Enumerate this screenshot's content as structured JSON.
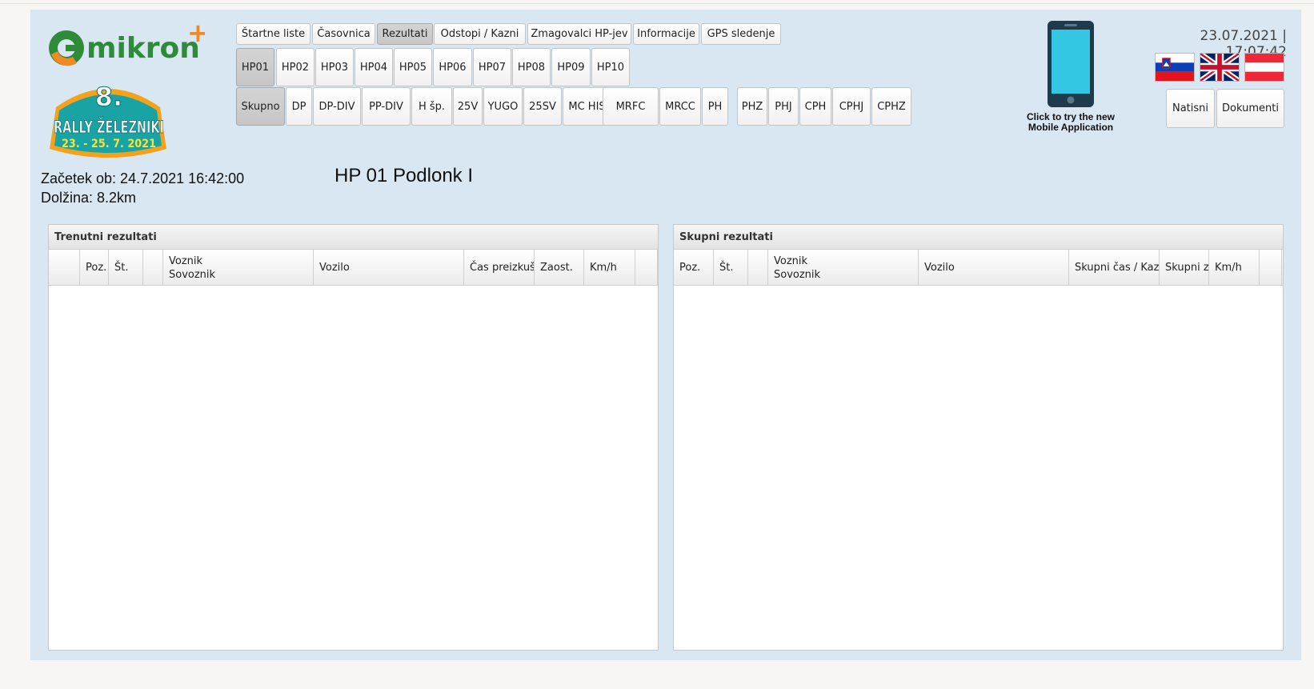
{
  "nav": {
    "main_tabs": [
      "Štartne liste",
      "Časovnica",
      "Rezultati",
      "Odstopi / Kazni",
      "Zmagovalci HP-jev",
      "Informacije",
      "GPS sledenje"
    ],
    "main_active": "Rezultati",
    "stages": [
      "HP01",
      "HP02",
      "HP03",
      "HP04",
      "HP05",
      "HP06",
      "HP07",
      "HP08",
      "HP09",
      "HP10"
    ],
    "stage_active": "HP01",
    "classes": [
      "Skupno",
      "DP",
      "DP-DIV",
      "PP-DIV",
      "H šp.",
      "25V",
      "YUGO",
      "25SV",
      "MC HIST",
      "MRFC",
      "MRCC",
      "PH",
      "PHZ",
      "PHJ",
      "CPH",
      "CPHJ",
      "CPHZ"
    ],
    "class_active": "Skupno"
  },
  "logos": {
    "mikron": "mikron",
    "mikron_plus": "+",
    "rally_number": "8.",
    "rally_name": "RALLY ŽELEZNIKI",
    "rally_dates": "23. - 25. 7. 2021"
  },
  "mobile": {
    "line1": "Click to try the new",
    "line2": "Mobile Application",
    "icon": "smartphone-icon"
  },
  "datetime": "23.07.2021 | 17:07:42",
  "languages": [
    "slovenian-flag-icon",
    "english-flag-icon",
    "austrian-flag-icon"
  ],
  "actions": {
    "print": "Natisni",
    "documents": "Dokumenti"
  },
  "stage_info": {
    "start": "Začetek ob: 24.7.2021 16:42:00",
    "length": "Dolžina: 8.2km",
    "title": "HP 01 Podlonk I"
  },
  "current_results": {
    "title": "Trenutni rezultati",
    "columns": [
      "",
      "Poz.",
      "Št.",
      "",
      "Voznik",
      "Sovoznik",
      "Vozilo",
      "Čas preizkušnje",
      "Zaost.",
      "Km/h"
    ]
  },
  "total_results": {
    "title": "Skupni rezultati",
    "columns": [
      "Poz.",
      "Št.",
      "",
      "Voznik",
      "Sovoznik",
      "Vozilo",
      "Skupni čas / Kazni",
      "Skupni zaostanek",
      "Km/h"
    ]
  },
  "colors": {
    "background": "#d8e7f1",
    "mikron_green": "#2e8b3a",
    "mikron_orange": "#f08a24",
    "phone_screen": "#33c7e3"
  }
}
